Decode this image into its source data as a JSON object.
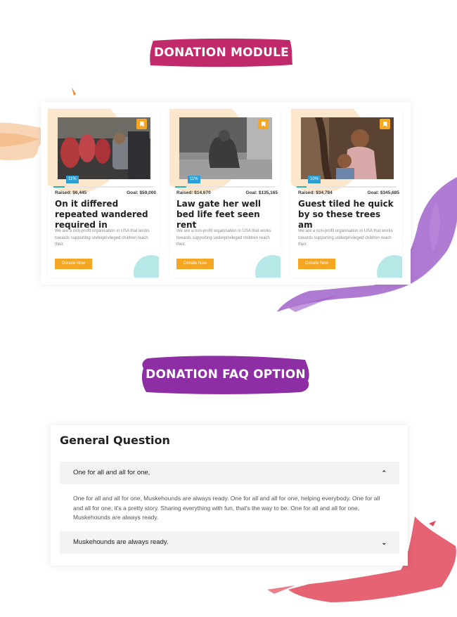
{
  "headings": {
    "module": "DONATION MODULE",
    "faq": "DONATION FAQ OPTION"
  },
  "colors": {
    "brush_magenta": "#c02a6b",
    "brush_purple": "#8e2ea4",
    "accent_orange": "#f5a623",
    "progress_teal": "#2bb5b3",
    "percent_blue": "#2b9fd6"
  },
  "donations": [
    {
      "progress": 0.11,
      "percent": "11%",
      "raised": "Raised: $6,445",
      "goal": "Goal: $59,000",
      "title": "On it differed repeated wandered required in",
      "description": "We are a non-profit organisation in USA that works towards supporting underprivileged children reach their.",
      "button": "Donate Now",
      "icon": "bookmark-icon"
    },
    {
      "progress": 0.11,
      "percent": "11%",
      "raised": "Raised: $14,670",
      "goal": "Goal: $135,165",
      "title": "Law gate her well bed life feet seen rent",
      "description": "We are a non-profit organisation in USA that works towards supporting underprivileged children reach their.",
      "button": "Donate Now",
      "icon": "bookmark-icon"
    },
    {
      "progress": 0.1,
      "percent": "10%",
      "raised": "Raised: $34,784",
      "goal": "Goal: $345,685",
      "title": "Guest tiled he quick by so these trees am",
      "description": "We are a non-profit organisation in USA that works towards supporting underprivileged children reach their.",
      "button": "Donate Now",
      "icon": "bookmark-icon"
    }
  ],
  "faq": {
    "heading": "General Question",
    "items": [
      {
        "question": "One for all and all for one,",
        "answer": "One for all and all for one, Muskehounds are always ready. One for all and all for one, helping everybody. One for all and all for one, it's a pretty story. Sharing everything with fun, that's the way to be. One for all and all for one, Muskehounds are always ready.",
        "expanded": true,
        "icon": "chevron-up-icon"
      },
      {
        "question": "Muskehounds are always ready.",
        "expanded": false,
        "icon": "chevron-down-icon"
      }
    ]
  }
}
